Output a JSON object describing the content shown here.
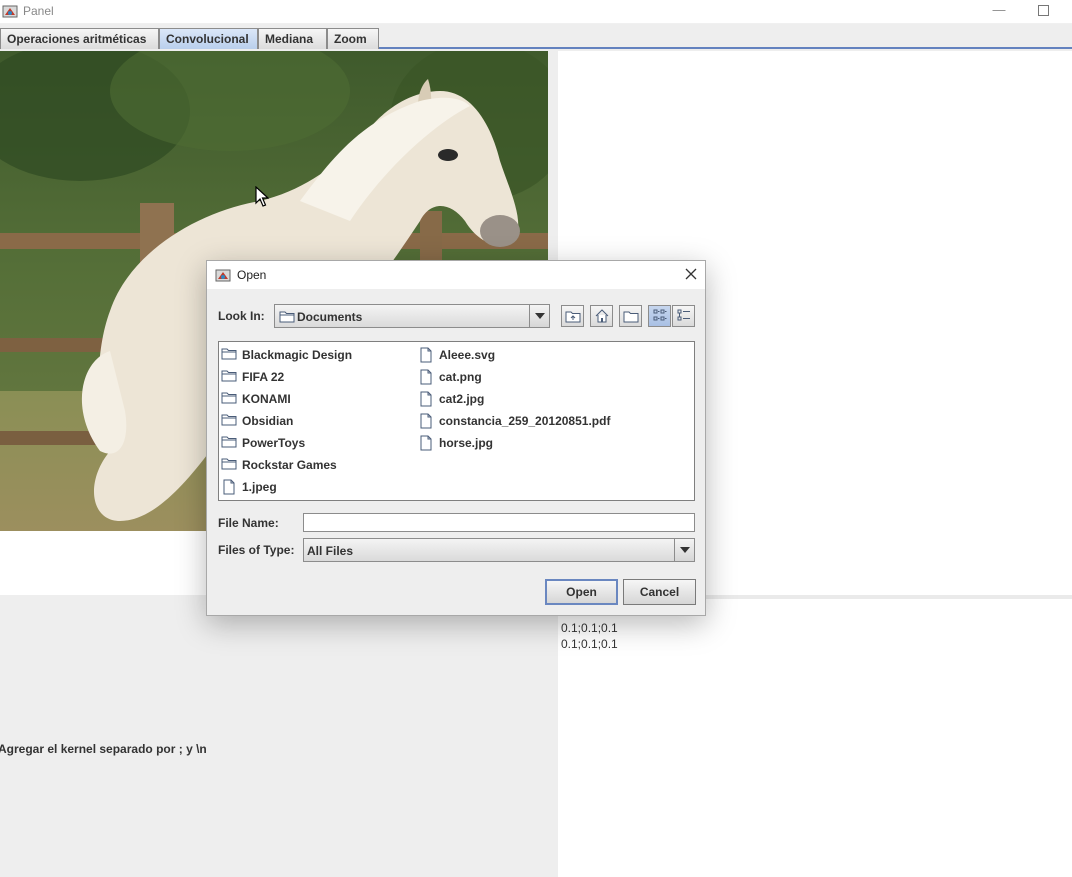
{
  "window": {
    "title": "Panel"
  },
  "tabs": [
    {
      "label": "Operaciones aritméticas",
      "selected": false
    },
    {
      "label": "Convolucional",
      "selected": true
    },
    {
      "label": "Mediana",
      "selected": false
    },
    {
      "label": "Zoom",
      "selected": false
    }
  ],
  "kernel_text": [
    "0.1;0.1;0.1",
    "0.1;0.1;0.1"
  ],
  "instructions": "Agregar el kernel separado por ; y \\n",
  "dialog": {
    "title": "Open",
    "look_in_label": "Look In:",
    "look_in_value": "Documents",
    "toolbar_icons": [
      "up-one-level-icon",
      "home-icon",
      "new-folder-icon",
      "list-view-icon",
      "details-view-icon"
    ],
    "files_col1": [
      {
        "name": "Blackmagic Design",
        "kind": "folder"
      },
      {
        "name": "FIFA 22",
        "kind": "folder"
      },
      {
        "name": "KONAMI",
        "kind": "folder"
      },
      {
        "name": "Obsidian",
        "kind": "folder"
      },
      {
        "name": "PowerToys",
        "kind": "folder"
      },
      {
        "name": "Rockstar Games",
        "kind": "folder"
      },
      {
        "name": "1.jpeg",
        "kind": "file"
      }
    ],
    "files_col2": [
      {
        "name": "Aleee.svg",
        "kind": "file"
      },
      {
        "name": "cat.png",
        "kind": "file"
      },
      {
        "name": "cat2.jpg",
        "kind": "file"
      },
      {
        "name": "constancia_259_20120851.pdf",
        "kind": "file"
      },
      {
        "name": "horse.jpg",
        "kind": "file"
      }
    ],
    "file_name_label": "File Name:",
    "file_name_value": "",
    "files_of_type_label": "Files of Type:",
    "files_of_type_value": "All Files",
    "open_button": "Open",
    "cancel_button": "Cancel"
  },
  "colors": {
    "tab_accent": "#6382bf",
    "selected_tab": "#b9cfec",
    "panel_bg": "#eeeeee"
  }
}
